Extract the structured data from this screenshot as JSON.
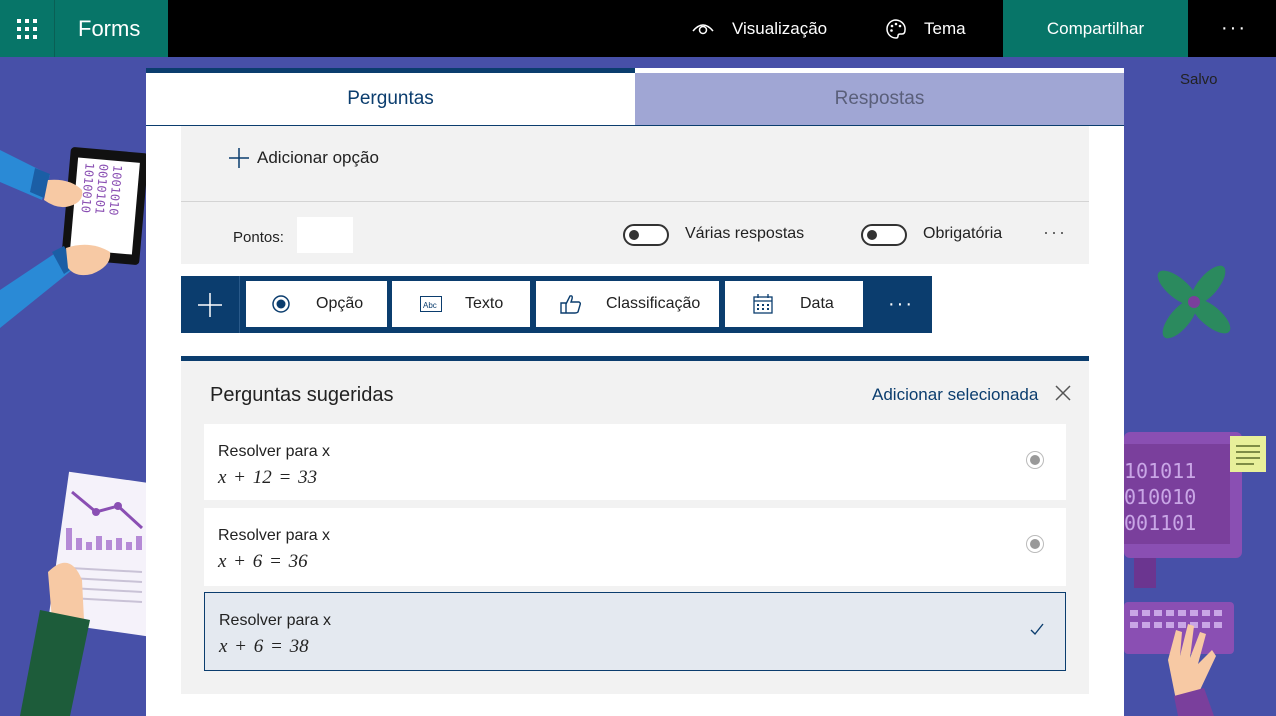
{
  "topbar": {
    "app_name": "Forms",
    "preview_label": "Visualização",
    "theme_label": "Tema",
    "share_label": "Compartilhar",
    "more_label": "···"
  },
  "status": {
    "saved": "Salvo"
  },
  "tabs": [
    {
      "label": "Perguntas",
      "active": true
    },
    {
      "label": "Respostas",
      "active": false
    }
  ],
  "question": {
    "add_option_label": "Adicionar opção",
    "points_label": "Pontos:",
    "points_value": "",
    "multiple_answers_label": "Várias respostas",
    "multiple_answers_on": false,
    "required_label": "Obrigatória",
    "required_on": false,
    "more_label": "···"
  },
  "question_types": {
    "items": [
      {
        "label": "Opção",
        "icon": "radio-icon"
      },
      {
        "label": "Texto",
        "icon": "text-abc-icon"
      },
      {
        "label": "Classificação",
        "icon": "thumbs-up-icon"
      },
      {
        "label": "Data",
        "icon": "calendar-icon"
      }
    ],
    "more_label": "···"
  },
  "suggestions": {
    "title": "Perguntas sugeridas",
    "add_selected_label": "Adicionar selecionada",
    "items": [
      {
        "title": "Resolver para x",
        "equation": "x + 12 = 33",
        "selected": false
      },
      {
        "title": "Resolver para x",
        "equation": "x + 6 = 36",
        "selected": false
      },
      {
        "title": "Resolver para x",
        "equation": "x + 6 = 38",
        "selected": true
      }
    ]
  },
  "decor_text": {
    "binary_tablet": [
      "1001010",
      "0010101",
      "1010010"
    ],
    "binary_monitor": [
      "101011",
      "010010",
      "001101"
    ]
  },
  "colors": {
    "brand_teal": "#077568",
    "nav_blue": "#0b3d6e",
    "background": "#4750a8",
    "inactive_tab": "#a0a6d4"
  }
}
